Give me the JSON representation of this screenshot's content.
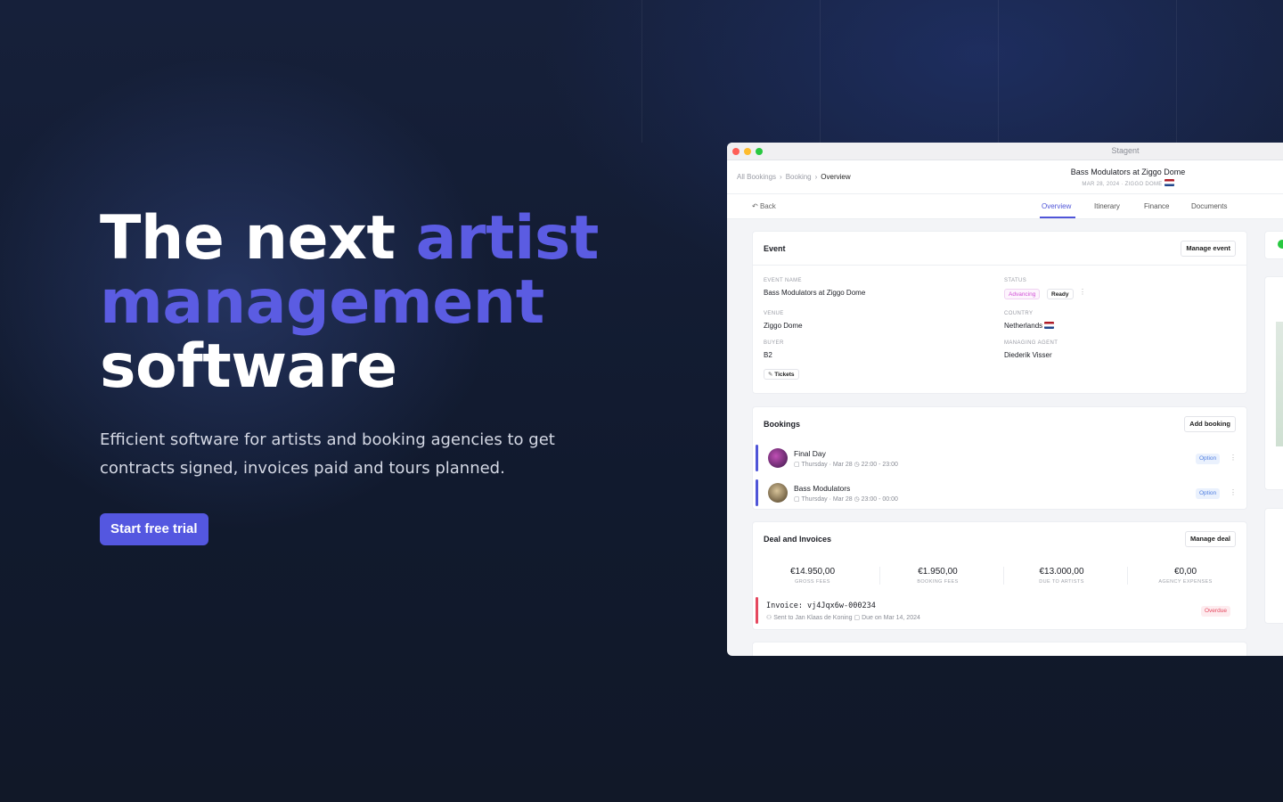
{
  "hero": {
    "title_line1_plain": "The next ",
    "title_line1_accent": "artist",
    "title_line2_accent": "management",
    "title_line3_plain": "software",
    "subtitle": "Efficient software for artists and booking agencies to get contracts signed, invoices paid and tours planned.",
    "cta_label": "Start free trial"
  },
  "colors": {
    "accent": "#5b5ce2",
    "button": "#5457e0",
    "background": "#121a2f"
  },
  "app": {
    "window_title": "Stagent",
    "breadcrumb": [
      "All Bookings",
      "Booking",
      "Overview"
    ],
    "event_title": "Bass Modulators at Ziggo Dome",
    "event_subtitle": "MAR 28, 2024 · ZIGGO DOME",
    "back_label": "Back",
    "tabs": [
      "Overview",
      "Itinerary",
      "Finance",
      "Documents"
    ],
    "event_card": {
      "heading": "Event",
      "button": "Manage event",
      "event_name_label": "EVENT NAME",
      "event_name": "Bass Modulators at Ziggo Dome",
      "status_label": "STATUS",
      "status_advancing": "Advancing",
      "status_ready": "Ready",
      "venue_label": "VENUE",
      "venue": "Ziggo Dome",
      "country_label": "COUNTRY",
      "country": "Netherlands",
      "buyer_label": "BUYER",
      "buyer": "B2",
      "agent_label": "MANAGING AGENT",
      "agent": "Diederik Visser",
      "tickets": "Tickets"
    },
    "bookings_card": {
      "heading": "Bookings",
      "button": "Add booking",
      "items": [
        {
          "name": "Final Day",
          "date": "Thursday · Mar 28",
          "time": "22:00 - 23:00",
          "status": "Option"
        },
        {
          "name": "Bass Modulators",
          "date": "Thursday · Mar 28",
          "time": "23:00 - 00:00",
          "status": "Option"
        }
      ]
    },
    "deal_card": {
      "heading": "Deal and Invoices",
      "button": "Manage deal",
      "fees": [
        {
          "value": "€14.950,00",
          "label": "GROSS FEES"
        },
        {
          "value": "€1.950,00",
          "label": "BOOKING FEES"
        },
        {
          "value": "€13.000,00",
          "label": "DUE TO ARTISTS"
        },
        {
          "value": "€0,00",
          "label": "AGENCY EXPENSES"
        }
      ],
      "invoice_title": "Invoice: vj4Jqx6w-000234",
      "invoice_sent": "Sent to Jan Klaas de Koning",
      "invoice_due": "Due on Mar 14, 2024",
      "invoice_status": "Overdue"
    }
  }
}
